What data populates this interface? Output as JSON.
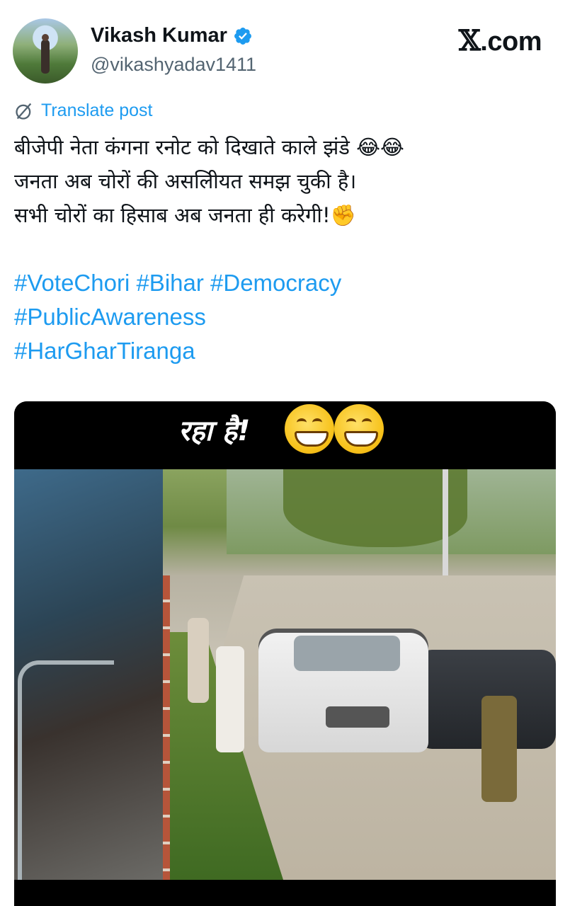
{
  "author": {
    "name": "Vikash Kumar",
    "handle": "@vikashyadav1411",
    "verified": true
  },
  "brand": {
    "x_glyph": "𝕏",
    "suffix": ".com"
  },
  "translate_label": "Translate post",
  "post": {
    "lines": [
      "बीजेपी नेता कंगना रनोट को दिखाते काले झंडे 😂😂",
      "जनता अब चोरों की असलीियत समझ चुकी है।",
      "सभी चोरों का हिसाब अब जनता ही करेगी!✊"
    ],
    "hashtag_lines": [
      [
        "#VoteChori",
        "#Bihar",
        "#Democracy"
      ],
      [
        "#PublicAwareness"
      ],
      [
        "#HarGharTiranga"
      ]
    ]
  },
  "media": {
    "caption_text": "रहा है!",
    "caption_emoji_count": 2
  },
  "colors": {
    "link": "#1d9bf0",
    "text": "#0f1419",
    "secondary": "#536471",
    "verified": "#1d9bf0"
  }
}
